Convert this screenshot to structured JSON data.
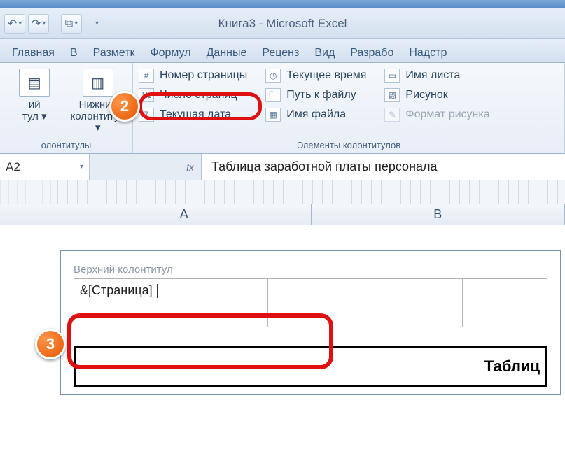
{
  "title": "Книга3  -  Microsoft Excel",
  "tabs": [
    "Главная",
    "В",
    "Разметк",
    "Формул",
    "Данные",
    "Реценз",
    "Вид",
    "Разрабо",
    "Надстр"
  ],
  "ribbon": {
    "group1": {
      "big1_line1": "ий",
      "big1_line2": "тул ▾",
      "big2_line1": "Нижний",
      "big2_line2": "колонтитул ▾",
      "label": "олонтитулы"
    },
    "group2": {
      "page_number": "Номер страницы",
      "page_count": "Число страниц",
      "current_date": "Текущая дата",
      "current_time": "Текущее время",
      "file_path": "Путь к файлу",
      "file_name": "Имя файла",
      "sheet_name": "Имя листа",
      "picture": "Рисунок",
      "format_picture": "Формат рисунка",
      "label": "Элементы колонтитулов"
    }
  },
  "namebox": "A2",
  "formula": "Таблица заработной платы персонала",
  "columns": [
    "A",
    "B"
  ],
  "header_label": "Верхний колонтитул",
  "header_left_value": "&[Страница]",
  "table_caption": "Таблиц",
  "badges": {
    "two": "2",
    "three": "3"
  },
  "fx_symbol": "fx"
}
